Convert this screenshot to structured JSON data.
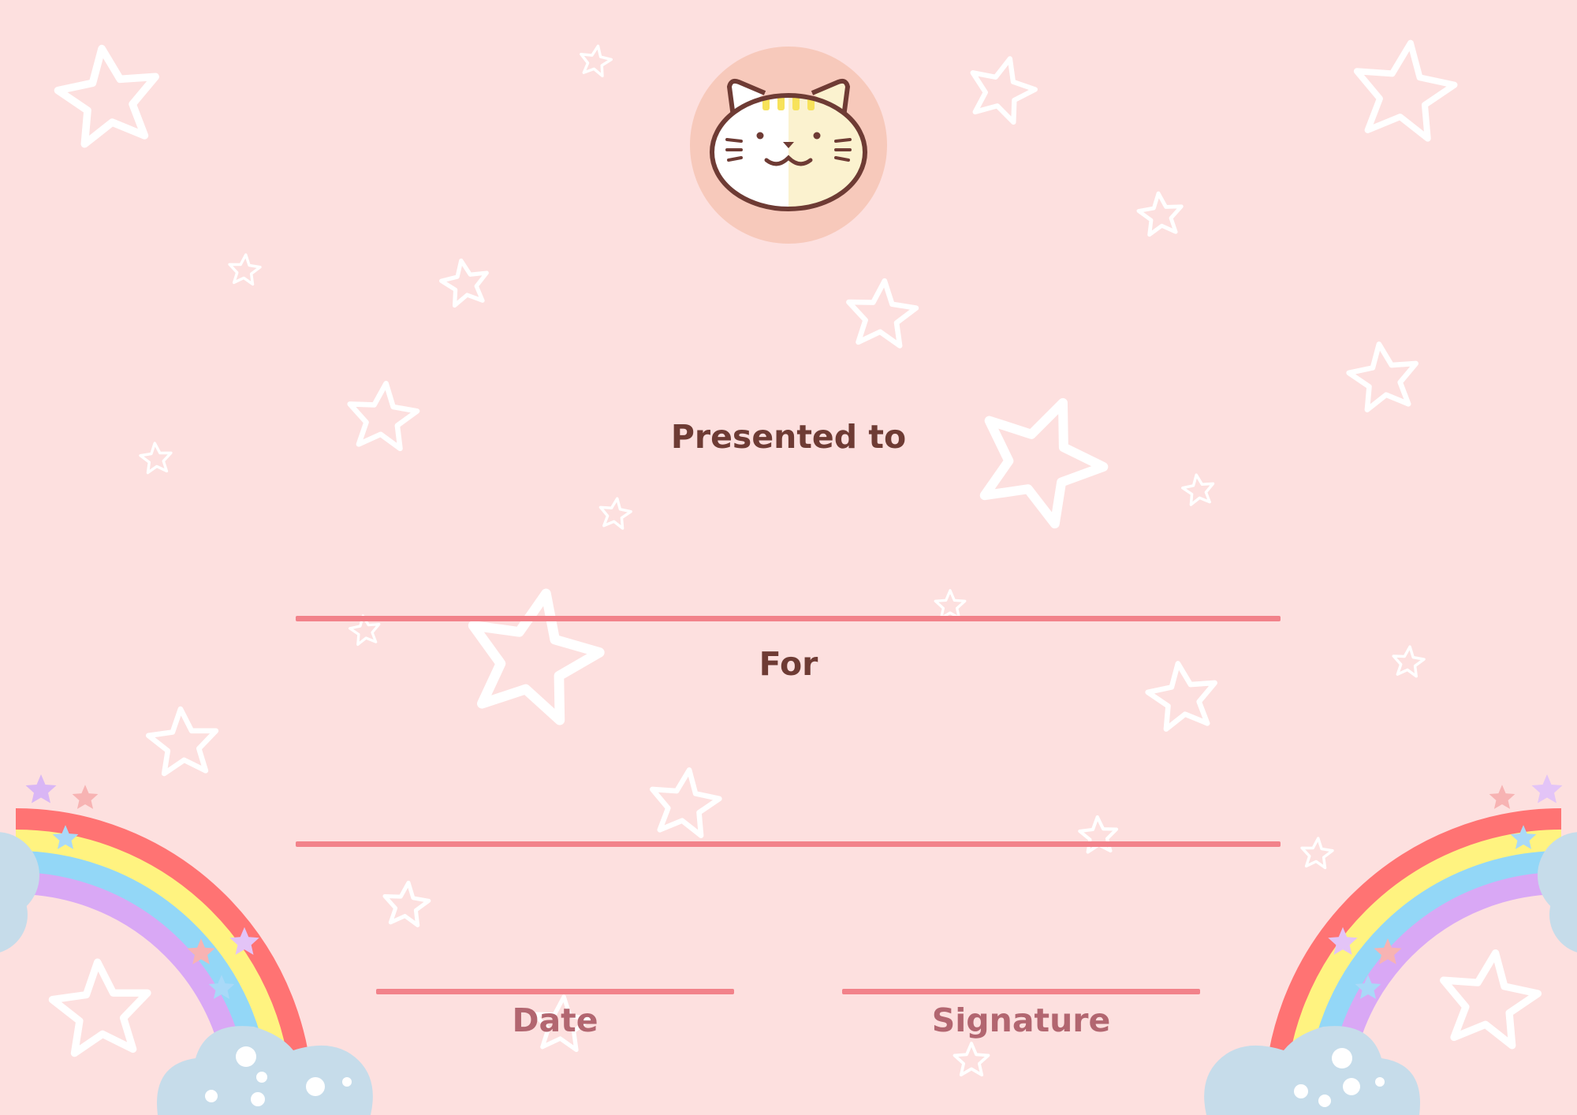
{
  "certificate": {
    "presented_label": "Presented to",
    "for_label": "For",
    "date_label": "Date",
    "signature_label": "Signature"
  },
  "colors": {
    "background": "#fde0df",
    "heading_text": "#6e3b34",
    "footer_text": "#b26670",
    "rule": "#f2828a",
    "badge": "#f7c9bb"
  },
  "icons": [
    "cat-face-icon",
    "star-outline-icon",
    "rainbow-icon",
    "cloud-icon"
  ]
}
